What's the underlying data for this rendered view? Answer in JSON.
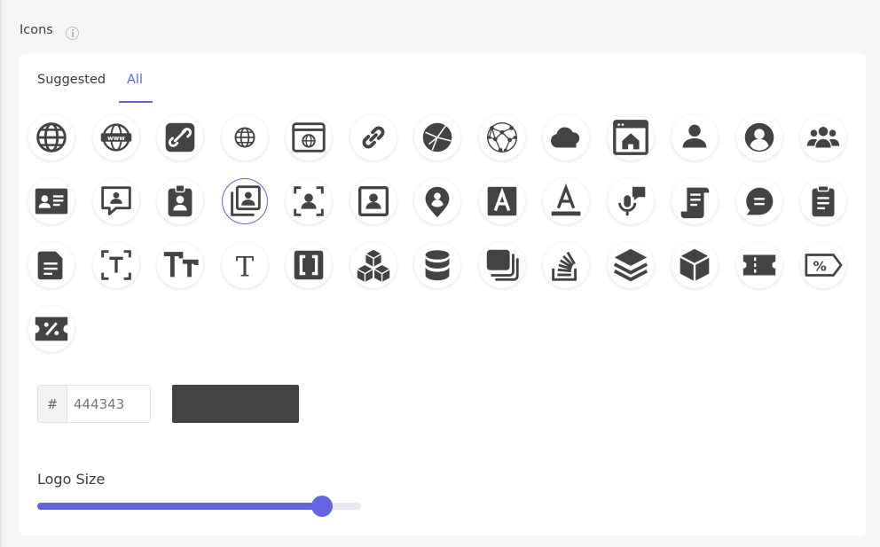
{
  "section": {
    "title": "Icons"
  },
  "tabs": [
    {
      "label": "Suggested",
      "active": false
    },
    {
      "label": "All",
      "active": true
    }
  ],
  "icons": [
    "globe-icon",
    "www-globe-icon",
    "link-square-icon",
    "globe-small-icon",
    "browser-globe-icon",
    "link-icon",
    "network-globe-icon",
    "network-sphere-icon",
    "cloud-icon",
    "browser-home-icon",
    "person-icon",
    "user-circle-icon",
    "users-group-icon",
    "id-card-icon",
    "comment-user-icon",
    "badge-user-icon",
    "contact-album-icon",
    "face-scan-icon",
    "contact-square-icon",
    "location-user-icon",
    "letter-a-square-icon",
    "text-color-icon",
    "mic-chat-icon",
    "scroll-document-icon",
    "chat-bubble-icon",
    "clipboard-icon",
    "file-text-icon",
    "text-frame-icon",
    "text-height-icon",
    "font-t-icon",
    "brackets-square-icon",
    "cubes-icon",
    "database-icon",
    "stacked-squares-icon",
    "stack-overflow-icon",
    "layers-icon",
    "cube-icon",
    "ticket-icon",
    "price-tag-percent-icon",
    "coupon-percent-icon"
  ],
  "selected_icon": "contact-album-icon",
  "color": {
    "prefix": "#",
    "hex": "444343",
    "swatch": "#444343"
  },
  "accent": "#6366e0",
  "icon_color": "#444343",
  "logo_size": {
    "label": "Logo Size",
    "value": 0.88
  }
}
